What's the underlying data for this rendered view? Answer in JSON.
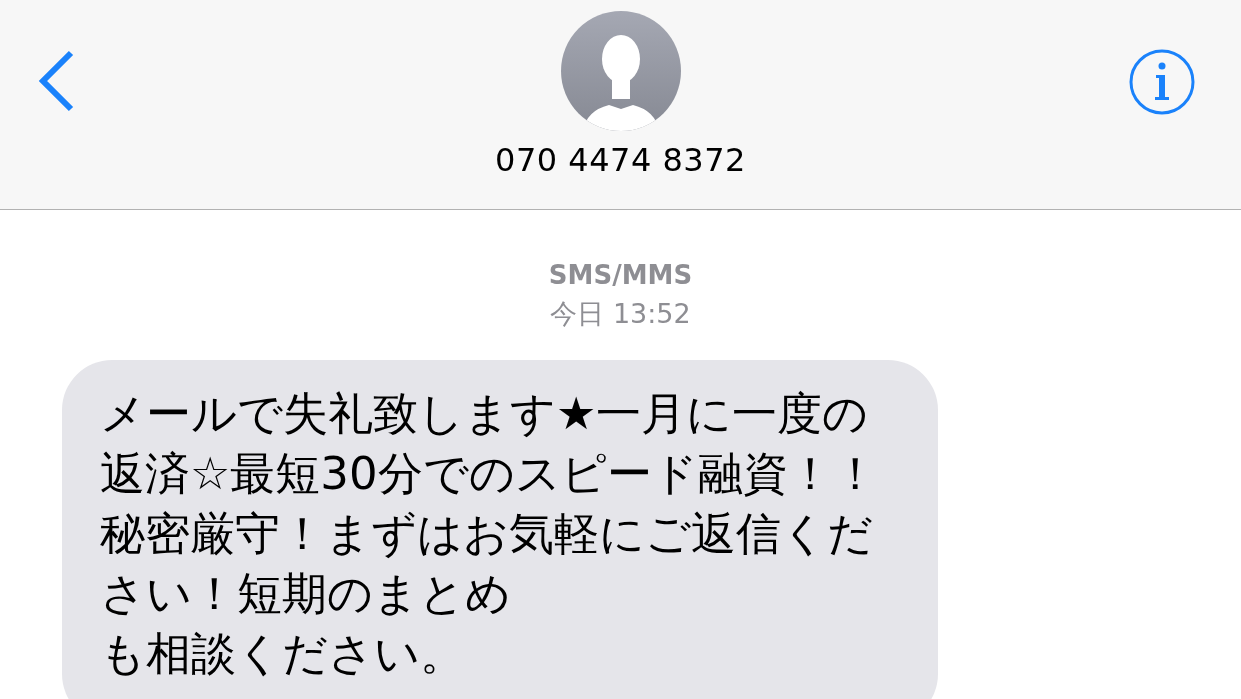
{
  "header": {
    "contact": "070 4474 8372"
  },
  "conversation": {
    "service": "SMS/MMS",
    "timestamp": "今日 13:52"
  },
  "messages": [
    {
      "kind": "incoming",
      "paragraphs": [
        "メールで失礼致します★一月に一度の返済☆最短30分でのスピード融資！！秘密厳守！まずはお気軽にご返信ください！短期のまとめ",
        "も相談ください。"
      ]
    }
  ]
}
